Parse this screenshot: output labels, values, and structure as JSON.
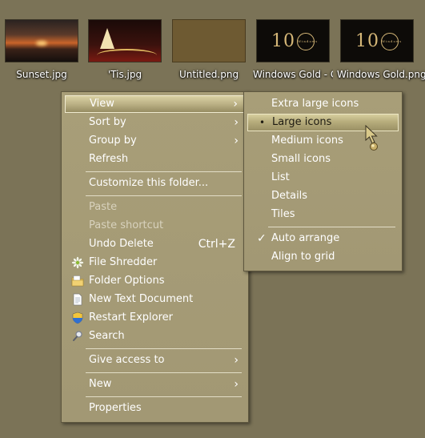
{
  "desktop_icons": [
    {
      "label": "Sunset.jpg"
    },
    {
      "label": "'Tis.jpg"
    },
    {
      "label": "Untitled.png"
    },
    {
      "label": "Windows Gold - Copy.bmp"
    },
    {
      "label": "Windows Gold.png"
    }
  ],
  "thumb_mark": {
    "digits": "10",
    "ring_text": "Windows"
  },
  "context_menu": {
    "view": "View",
    "sort_by": "Sort by",
    "group_by": "Group by",
    "refresh": "Refresh",
    "customize": "Customize this folder...",
    "paste": "Paste",
    "paste_shortcut": "Paste shortcut",
    "undo_delete": "Undo Delete",
    "undo_shortcut": "Ctrl+Z",
    "file_shredder": "File Shredder",
    "folder_options": "Folder Options",
    "new_text_document": "New Text Document",
    "restart_explorer": "Restart Explorer",
    "search": "Search",
    "give_access_to": "Give access to",
    "new": "New",
    "properties": "Properties",
    "submenu_arrow": "›"
  },
  "view_submenu": {
    "extra_large": "Extra large icons",
    "large": "Large icons",
    "medium": "Medium icons",
    "small": "Small icons",
    "list": "List",
    "details": "Details",
    "tiles": "Tiles",
    "auto_arrange": "Auto arrange",
    "align_to_grid": "Align to grid",
    "selected_bullet": "•",
    "checkmark": "✓"
  },
  "colors": {
    "desktop_bg": "#7b7357",
    "menu_bg": "#a89e78",
    "highlight": "#c9c092",
    "text": "#ffffff"
  }
}
